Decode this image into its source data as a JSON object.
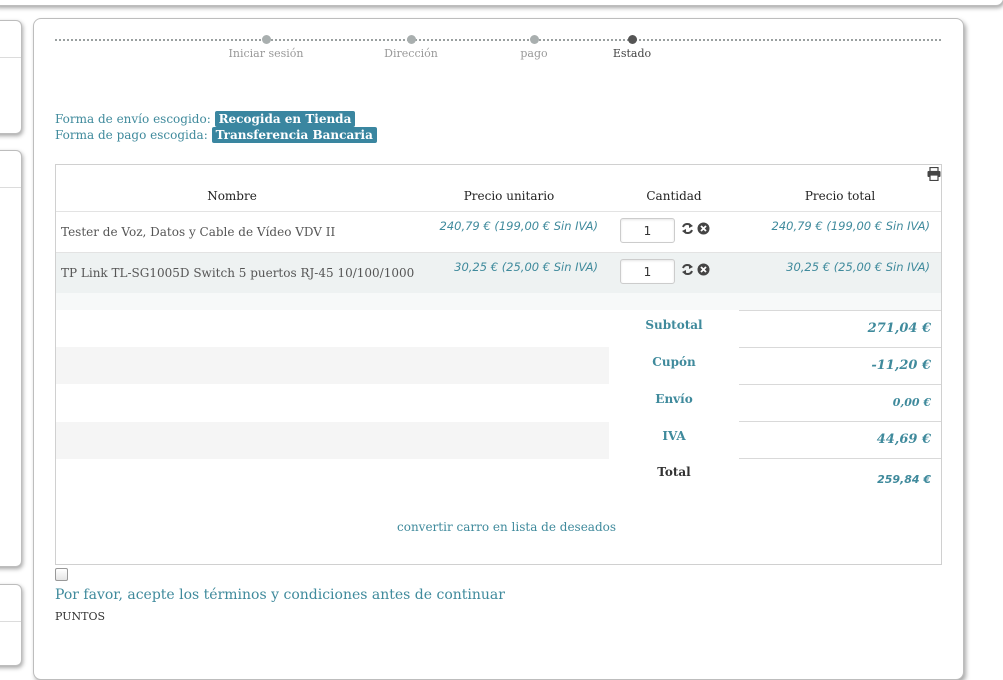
{
  "steps": [
    {
      "label": "Iniciar sesión",
      "active": false
    },
    {
      "label": "Dirección",
      "active": false
    },
    {
      "label": "pago",
      "active": false
    },
    {
      "label": "Estado",
      "active": true
    }
  ],
  "shipping": {
    "envio_label": "Forma de envío escogido:",
    "envio_value": "Recogida en Tienda",
    "pago_label": "Forma de pago escogida:",
    "pago_value": "Transferencia Bancaria"
  },
  "table": {
    "headers": [
      "Nombre",
      "Precio unitario",
      "Cantidad",
      "Precio total"
    ],
    "rows": [
      {
        "name": "Tester de Voz, Datos y Cable de Vídeo VDV II",
        "unit": "240,79 € (199,00 € Sin IVA)",
        "qty": "1",
        "total": "240,79 € (199,00 € Sin IVA)"
      },
      {
        "name": "TP Link TL-SG1005D Switch 5 puertos RJ-45 10/100/1000",
        "unit": "30,25 € (25,00 € Sin IVA)",
        "qty": "1",
        "total": "30,25 € (25,00 € Sin IVA)"
      }
    ]
  },
  "summary": [
    {
      "label": "Subtotal",
      "value": "271,04 €"
    },
    {
      "label": "Cupón",
      "value": "-11,20 €"
    },
    {
      "label": "Envío",
      "value": "0,00 €"
    },
    {
      "label": "IVA",
      "value": "44,69 €"
    },
    {
      "label": "Total",
      "value": "259,84 €"
    }
  ],
  "wishlist_link": "convertir carro en lista de deseados",
  "terms_text": "Por favor, acepte los términos y condiciones antes de continuar",
  "puntos_label": "PUNTOS",
  "icons": {
    "print": "print-icon",
    "refresh": "refresh-icon",
    "remove": "remove-icon"
  },
  "colors": {
    "accent": "#3f8a9c",
    "tag_bg": "#3a86a0"
  }
}
